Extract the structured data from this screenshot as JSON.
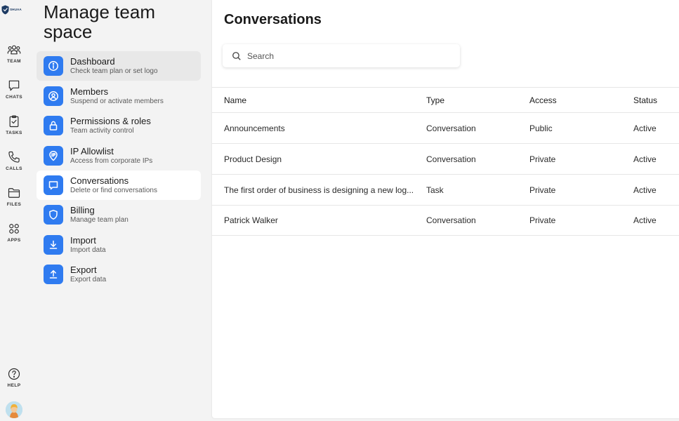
{
  "brand": {
    "name": "SHUAA",
    "sub": ""
  },
  "rail": {
    "items": [
      {
        "label": "TEAM",
        "icon": "team-icon"
      },
      {
        "label": "CHATS",
        "icon": "chat-icon"
      },
      {
        "label": "TASKS",
        "icon": "tasks-icon"
      },
      {
        "label": "CALLS",
        "icon": "phone-icon"
      },
      {
        "label": "FILES",
        "icon": "folder-icon"
      },
      {
        "label": "APPS",
        "icon": "apps-icon"
      }
    ],
    "help": {
      "label": "HELP",
      "icon": "help-icon"
    }
  },
  "settings": {
    "title": "Manage team space",
    "items": [
      {
        "label": "Dashboard",
        "desc": "Check team plan or set logo",
        "icon": "info-icon"
      },
      {
        "label": "Members",
        "desc": "Suspend or activate members",
        "icon": "user-icon"
      },
      {
        "label": "Permissions & roles",
        "desc": "Team activity control",
        "icon": "lock-icon"
      },
      {
        "label": "IP Allowlist",
        "desc": "Access from corporate IPs",
        "icon": "ip-icon"
      },
      {
        "label": "Conversations",
        "desc": "Delete or find conversations",
        "icon": "chat-bubble-icon"
      },
      {
        "label": "Billing",
        "desc": "Manage team plan",
        "icon": "shield-icon"
      },
      {
        "label": "Import",
        "desc": "Import data",
        "icon": "download-icon"
      },
      {
        "label": "Export",
        "desc": "Export data",
        "icon": "upload-icon"
      }
    ]
  },
  "main": {
    "title": "Conversations",
    "search": {
      "placeholder": "Search",
      "value": ""
    },
    "columns": [
      "Name",
      "Type",
      "Access",
      "Status"
    ],
    "rows": [
      {
        "name": "Announcements",
        "type": "Conversation",
        "access": "Public",
        "status": "Active"
      },
      {
        "name": "Product Design",
        "type": "Conversation",
        "access": "Private",
        "status": "Active"
      },
      {
        "name": "The first order of business is designing a new log...",
        "type": "Task",
        "access": "Private",
        "status": "Active"
      },
      {
        "name": "Patrick Walker",
        "type": "Conversation",
        "access": "Private",
        "status": "Active"
      }
    ]
  },
  "colors": {
    "accent": "#2f7bf0",
    "panel": "#ffffff",
    "background": "#f3f3f3"
  }
}
